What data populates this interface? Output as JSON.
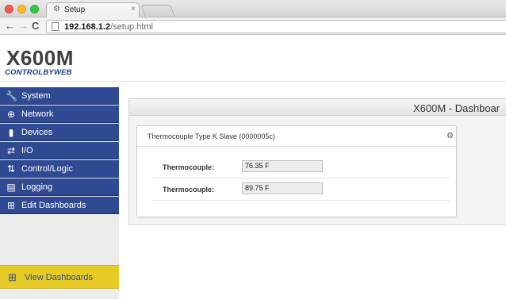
{
  "browser": {
    "tab_title": "Setup",
    "tab_favicon": "setup-favicon",
    "tab_close": "×",
    "url_host": "192.168.1.2",
    "url_path": "/setup.html"
  },
  "header": {
    "logo_mark": "X600M",
    "logo_sub": "CONTROLBYWEB"
  },
  "sidebar": {
    "items": [
      {
        "label": "System",
        "icon": "wrench-icon"
      },
      {
        "label": "Network",
        "icon": "globe-icon"
      },
      {
        "label": "Devices",
        "icon": "device-icon"
      },
      {
        "label": "I/O",
        "icon": "arrows-icon"
      },
      {
        "label": "Control/Logic",
        "icon": "logic-icon"
      },
      {
        "label": "Logging",
        "icon": "log-icon"
      },
      {
        "label": "Edit Dashboards",
        "icon": "dashboard-icon"
      }
    ],
    "view_dashboards": {
      "label": "View Dashboards",
      "icon": "dashboard-icon"
    }
  },
  "main": {
    "dashboard_title": "X600M - Dashboar",
    "card": {
      "title": "Thermocouple Type K Slave (0000005c)",
      "gear_icon": "gear-icon",
      "rows": [
        {
          "label": "Thermocouple:",
          "value": "76.35 F"
        },
        {
          "label": "Thermocouple:",
          "value": "89.75 F"
        }
      ]
    }
  },
  "colors": {
    "nav_blue": "#2f4a93",
    "highlight_yellow": "#e6ca26",
    "logo_blue": "#1a3d8f"
  }
}
